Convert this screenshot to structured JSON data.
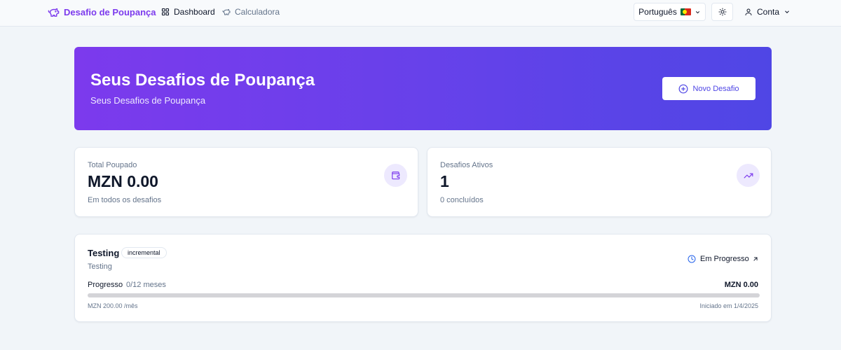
{
  "nav": {
    "brand": "Desafio de Poupança",
    "links": [
      {
        "label": "Dashboard",
        "icon": "grid-icon",
        "active": true
      },
      {
        "label": "Calculadora",
        "icon": "piggy-bank-icon",
        "active": false
      }
    ],
    "language": "Português",
    "account": "Conta"
  },
  "hero": {
    "title": "Seus Desafios de Poupança",
    "subtitle": "Seus Desafios de Poupança",
    "new_button": "Novo Desafio"
  },
  "stats": [
    {
      "label": "Total Poupado",
      "value": "MZN 0.00",
      "footnote": "Em todos os desafios",
      "icon": "wallet-icon"
    },
    {
      "label": "Desafios Ativos",
      "value": "1",
      "footnote": "0 concluídos",
      "icon": "trending-up-icon"
    }
  ],
  "challenge": {
    "name": "Testing",
    "badge": "incremental",
    "description": "Testing",
    "status": "Em Progresso",
    "progress_label": "Progresso",
    "progress_count": "0/12 meses",
    "progress_fraction": 0,
    "amount": "MZN 0.00",
    "rate": "MZN 200.00 /mês",
    "started": "Iniciado em 1/4/2025"
  },
  "colors": {
    "brand": "#7c3aed",
    "accent": "#4f46e5",
    "muted": "#64748b",
    "status_icon": "#2563eb"
  }
}
